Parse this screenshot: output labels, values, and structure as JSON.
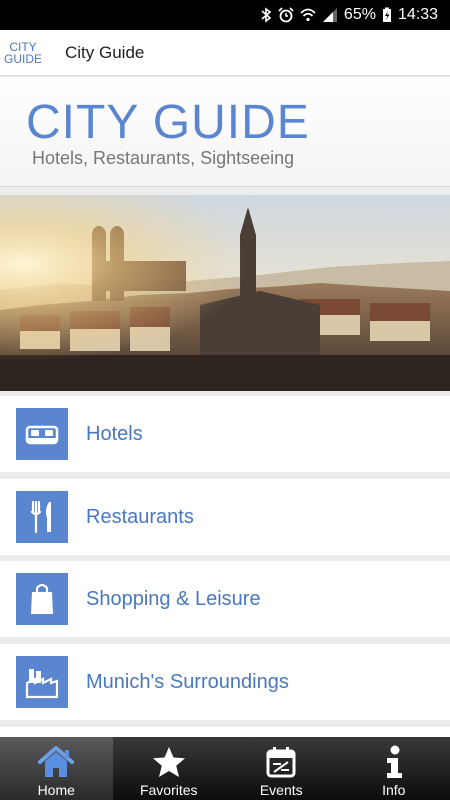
{
  "status_bar": {
    "battery": "65%",
    "time": "14:33"
  },
  "app_bar": {
    "logo_line1": "CITY",
    "logo_line2": "GUIDE",
    "title": "City Guide"
  },
  "header": {
    "title": "CITY GUIDE",
    "subtitle": "Hotels, Restaurants, Sightseeing"
  },
  "menu": {
    "items": [
      {
        "label": "Hotels",
        "icon": "bed-icon"
      },
      {
        "label": "Restaurants",
        "icon": "fork-knife-icon"
      },
      {
        "label": "Shopping & Leisure",
        "icon": "shopping-bag-icon"
      },
      {
        "label": "Munich's Surroundings",
        "icon": "factory-icon"
      }
    ]
  },
  "tabs": [
    {
      "label": "Home",
      "icon": "home-icon",
      "active": true
    },
    {
      "label": "Favorites",
      "icon": "star-icon"
    },
    {
      "label": "Events",
      "icon": "calendar-icon"
    },
    {
      "label": "Info",
      "icon": "info-icon"
    }
  ],
  "colors": {
    "accent": "#5a86cf",
    "label": "#4a78c0"
  }
}
